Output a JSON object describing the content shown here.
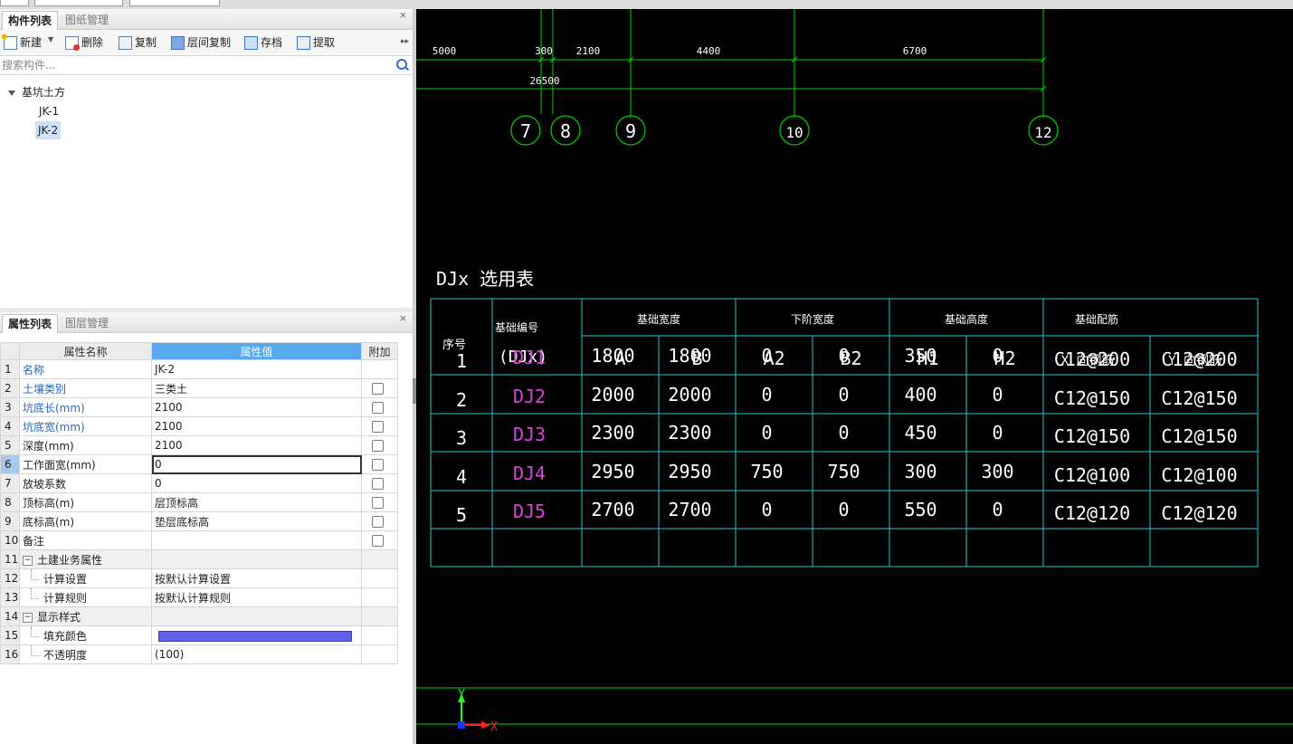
{
  "top_inputs": [
    {
      "value": ""
    },
    {
      "value": ""
    },
    {
      "value": ""
    }
  ],
  "component_panel": {
    "tabs": [
      "构件列表",
      "图纸管理"
    ],
    "close_glyph": "×",
    "toolbar": {
      "new": "新建",
      "delete": "删除",
      "copy": "复制",
      "layer_copy": "层间复制",
      "archive": "存档",
      "extract": "提取",
      "more_glyph": "▸▸"
    },
    "search_placeholder": "搜索构件...",
    "tree": {
      "group": "基坑土方",
      "items": [
        "JK-1",
        "JK-2"
      ],
      "selected": "JK-2"
    }
  },
  "property_panel": {
    "tabs": [
      "属性列表",
      "图层管理"
    ],
    "close_glyph": "×",
    "columns": [
      "属性名称",
      "属性值",
      "附加"
    ],
    "rows": [
      {
        "n": "1",
        "name": "名称",
        "value": "JK-2",
        "blue": true,
        "check": false
      },
      {
        "n": "2",
        "name": "土壤类别",
        "value": "三类土",
        "blue": true,
        "check": true
      },
      {
        "n": "3",
        "name": "坑底长(mm)",
        "value": "2100",
        "blue": true,
        "check": true
      },
      {
        "n": "4",
        "name": "坑底宽(mm)",
        "value": "2100",
        "blue": true,
        "check": true
      },
      {
        "n": "5",
        "name": "深度(mm)",
        "value": "2100",
        "blue": false,
        "check": true
      },
      {
        "n": "6",
        "name": "工作面宽(mm)",
        "value": "0",
        "blue": false,
        "check": true
      },
      {
        "n": "7",
        "name": "放坡系数",
        "value": "0",
        "blue": false,
        "check": true
      },
      {
        "n": "8",
        "name": "顶标高(m)",
        "value": "层顶标高",
        "blue": false,
        "check": true
      },
      {
        "n": "9",
        "name": "底标高(m)",
        "value": "垫层底标高",
        "blue": false,
        "check": true
      },
      {
        "n": "10",
        "name": "备注",
        "value": "",
        "blue": false,
        "check": true
      },
      {
        "n": "11",
        "name": "土建业务属性",
        "value": "",
        "group": true
      },
      {
        "n": "12",
        "name": "计算设置",
        "value": "按默认计算设置",
        "child": true
      },
      {
        "n": "13",
        "name": "计算规则",
        "value": "按默认计算规则",
        "child": true
      },
      {
        "n": "14",
        "name": "显示样式",
        "value": "",
        "group": true
      },
      {
        "n": "15",
        "name": "填充颜色",
        "value": "",
        "child": true,
        "color": "#6060e8"
      },
      {
        "n": "16",
        "name": "不透明度",
        "value": "(100)",
        "child": true
      }
    ],
    "active_row": "6",
    "group_collapse_glyph": "−"
  },
  "cad": {
    "dimensions": [
      "5000",
      "300",
      "2100",
      "4400",
      "6700"
    ],
    "total_dimension": "26500",
    "axis_labels": [
      "7",
      "8",
      "9",
      "10",
      "12"
    ],
    "table_title": "DJx 选用表",
    "table_headers": {
      "seq": "序号",
      "code_top": "基础编号",
      "code_bottom": "(DJx)",
      "width_group": "基础宽度",
      "step_group": "下阶宽度",
      "height_group": "基础高度",
      "rebar_group": "基础配筋",
      "sub": [
        "A",
        "B",
        "A2",
        "B2",
        "H1",
        "H2",
        "X 向钢筋",
        "Y 向钢筋"
      ]
    },
    "table_rows": [
      {
        "seq": "1",
        "code": "DJ1",
        "vals": [
          "1800",
          "1800",
          "0",
          "0",
          "350",
          "0",
          "C12@200",
          "C12@200"
        ]
      },
      {
        "seq": "2",
        "code": "DJ2",
        "vals": [
          "2000",
          "2000",
          "0",
          "0",
          "400",
          "0",
          "C12@150",
          "C12@150"
        ]
      },
      {
        "seq": "3",
        "code": "DJ3",
        "vals": [
          "2300",
          "2300",
          "0",
          "0",
          "450",
          "0",
          "C12@150",
          "C12@150"
        ]
      },
      {
        "seq": "4",
        "code": "DJ4",
        "vals": [
          "2950",
          "2950",
          "750",
          "750",
          "300",
          "300",
          "C12@100",
          "C12@100"
        ]
      },
      {
        "seq": "5",
        "code": "DJ5",
        "vals": [
          "2700",
          "2700",
          "0",
          "0",
          "550",
          "0",
          "C12@120",
          "C12@120"
        ]
      }
    ],
    "ucs": {
      "x": "X",
      "y": "Y"
    },
    "colors": {
      "grid": "#00d000",
      "table_border": "#22c8c8",
      "text": "#ffffff",
      "code": "#e040e0",
      "ucs_x": "#ff2020",
      "ucs_y": "#20ff20",
      "ucs_origin": "#2030ff"
    }
  }
}
